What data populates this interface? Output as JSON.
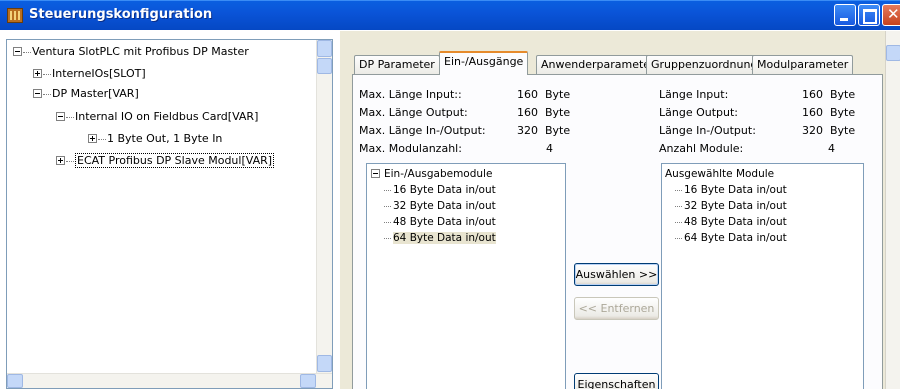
{
  "window": {
    "title": "Steuerungskonfiguration"
  },
  "tree": {
    "root": "Ventura SlotPLC mit Profibus DP Master",
    "internal_ios": "InterneIOs[SLOT]",
    "dp_master": "DP Master[VAR]",
    "fieldbus_card": "Internal IO on Fieldbus Card[VAR]",
    "byte_io": "1 Byte Out, 1 Byte In",
    "ecat_slave": "ECAT Profibus DP Slave Modul[VAR]"
  },
  "tabs": [
    {
      "label": "DP Parameter"
    },
    {
      "label": "Ein-/Ausgänge"
    },
    {
      "label": "Anwenderparameter"
    },
    {
      "label": "Gruppenzuordnung"
    },
    {
      "label": "Modulparameter"
    }
  ],
  "info_left": [
    {
      "label": "Max. Länge Input::",
      "value": "160",
      "unit": "Byte"
    },
    {
      "label": "Max. Länge Output:",
      "value": "160",
      "unit": "Byte"
    },
    {
      "label": "Max. Länge In-/Output:",
      "value": "320",
      "unit": "Byte"
    },
    {
      "label": "Max. Modulanzahl:",
      "value": "4",
      "unit": ""
    }
  ],
  "info_right": [
    {
      "label": "Länge Input:",
      "value": "160",
      "unit": "Byte"
    },
    {
      "label": "Länge Output:",
      "value": "160",
      "unit": "Byte"
    },
    {
      "label": "Länge In-/Output:",
      "value": "320",
      "unit": "Byte"
    },
    {
      "label": "Anzahl Module:",
      "value": "4",
      "unit": ""
    }
  ],
  "available_list": {
    "header": "Ein-/Ausgabemodule",
    "items": [
      "16 Byte Data in/out",
      "32 Byte Data in/out",
      "48 Byte Data in/out",
      "64 Byte Data in/out"
    ]
  },
  "selected_list": {
    "header": "Ausgewählte Module",
    "items": [
      "16 Byte Data in/out",
      "32 Byte Data in/out",
      "48 Byte Data in/out",
      "64 Byte Data in/out"
    ]
  },
  "buttons": {
    "select": "Auswählen >>",
    "remove": "<< Entfernen",
    "properties": "Eigenschaften"
  }
}
